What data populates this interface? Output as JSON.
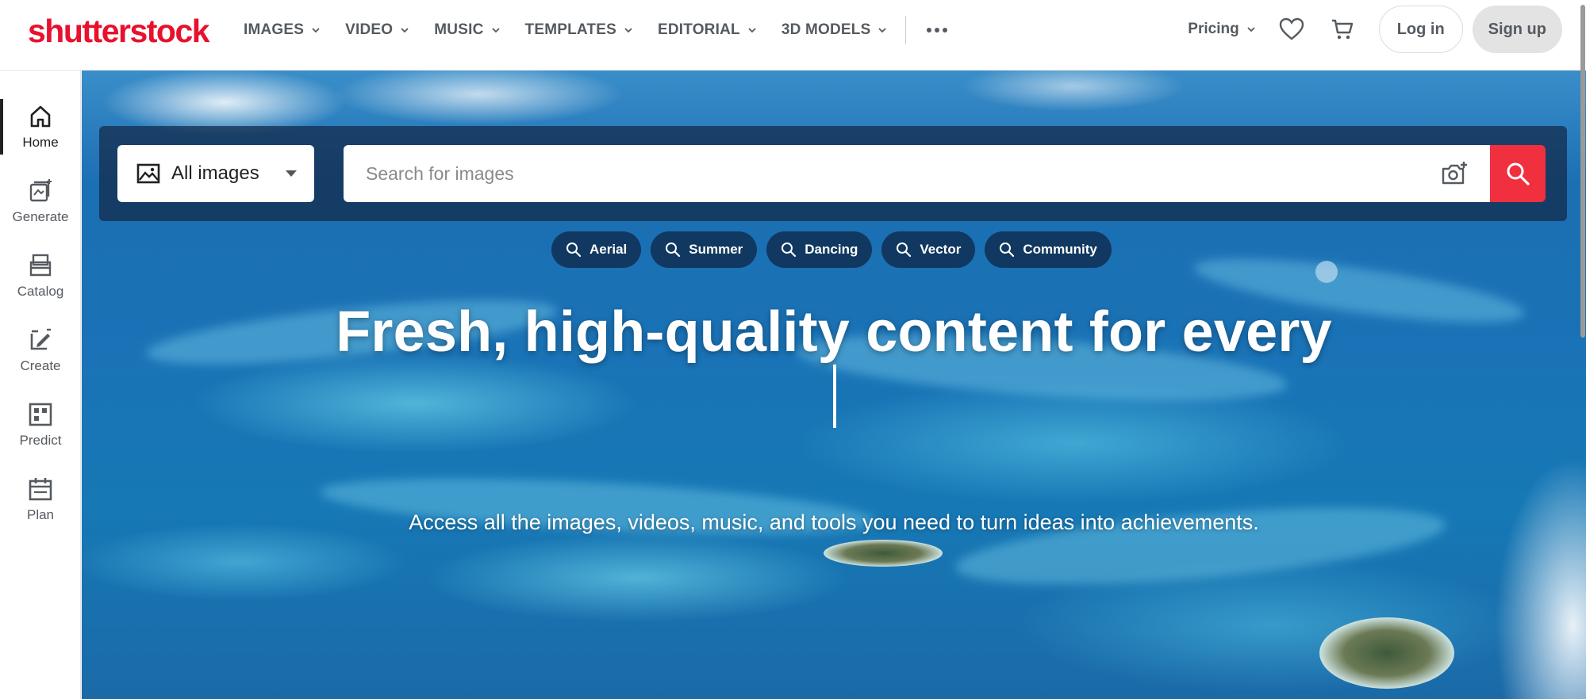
{
  "brand": {
    "logo_text": "shutterstock",
    "color": "#e8112d"
  },
  "nav": {
    "items": [
      {
        "label": "IMAGES"
      },
      {
        "label": "VIDEO"
      },
      {
        "label": "MUSIC"
      },
      {
        "label": "TEMPLATES"
      },
      {
        "label": "EDITORIAL"
      },
      {
        "label": "3D MODELS"
      }
    ],
    "more_icon": "more-horizontal-icon"
  },
  "header_right": {
    "pricing_label": "Pricing",
    "favorites_icon": "heart-icon",
    "cart_icon": "cart-icon",
    "login_label": "Log in",
    "signup_label": "Sign up"
  },
  "sidebar": {
    "items": [
      {
        "label": "Home",
        "icon": "home-icon",
        "active": true
      },
      {
        "label": "Generate",
        "icon": "generate-icon"
      },
      {
        "label": "Catalog",
        "icon": "catalog-icon"
      },
      {
        "label": "Create",
        "icon": "create-icon"
      },
      {
        "label": "Predict",
        "icon": "predict-icon"
      },
      {
        "label": "Plan",
        "icon": "plan-icon"
      }
    ]
  },
  "search": {
    "type_label": "All images",
    "placeholder": "Search for images",
    "value": "",
    "accent": "#f0303f"
  },
  "suggestions": [
    {
      "label": "Aerial"
    },
    {
      "label": "Summer"
    },
    {
      "label": "Dancing"
    },
    {
      "label": "Vector"
    },
    {
      "label": "Community"
    }
  ],
  "hero": {
    "headline": "Fresh, high-quality content for every",
    "subline": "Access all the images, videos, music, and tools you need to turn ideas into achievements."
  }
}
